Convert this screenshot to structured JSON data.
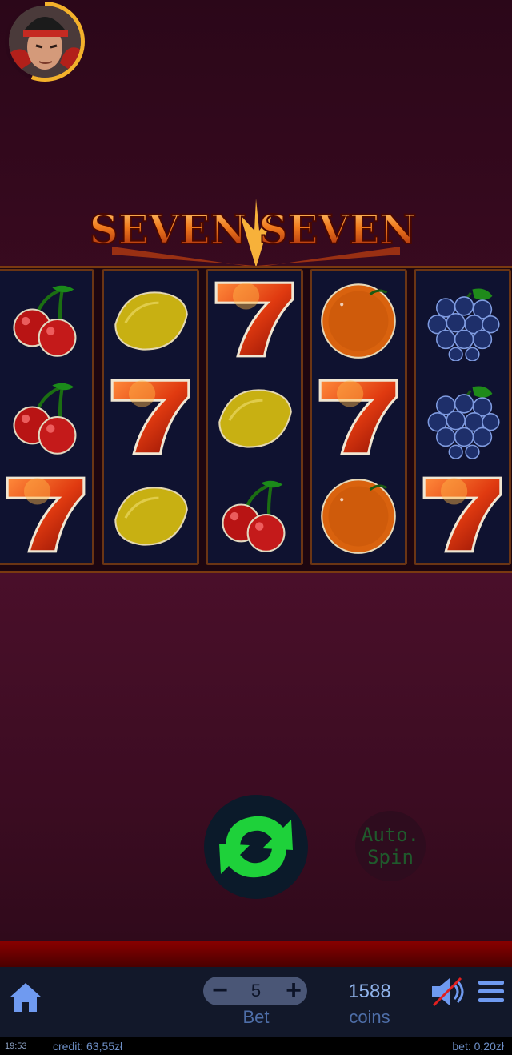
{
  "game": {
    "logo_word_1": "SEVEN",
    "logo_word_2": "SEVEN"
  },
  "reels": [
    [
      "cherry",
      "cherry",
      "seven"
    ],
    [
      "lemon",
      "seven",
      "lemon"
    ],
    [
      "seven",
      "lemon",
      "cherry"
    ],
    [
      "orange",
      "seven",
      "orange"
    ],
    [
      "grapes",
      "grapes",
      "seven"
    ]
  ],
  "controls": {
    "auto_spin_line1": "Auto.",
    "auto_spin_line2": "Spin",
    "spin_icon": "refresh-arrows-icon"
  },
  "bottom_bar": {
    "home_icon": "home-icon",
    "bet_minus": "−",
    "bet_plus": "+",
    "bet_value": "5",
    "bet_label": "Bet",
    "coins_value": "1588",
    "coins_label": "coins",
    "sound_icon": "sound-muted-icon",
    "menu_icon": "hamburger-menu-icon"
  },
  "status": {
    "time": "19:53",
    "credit": "credit: 63,55zł",
    "bet": "bet: 0,20zł"
  },
  "colors": {
    "spin_green": "#1ed13a",
    "accent_blue": "#8fb2ea",
    "reel_border": "#6b3514"
  }
}
